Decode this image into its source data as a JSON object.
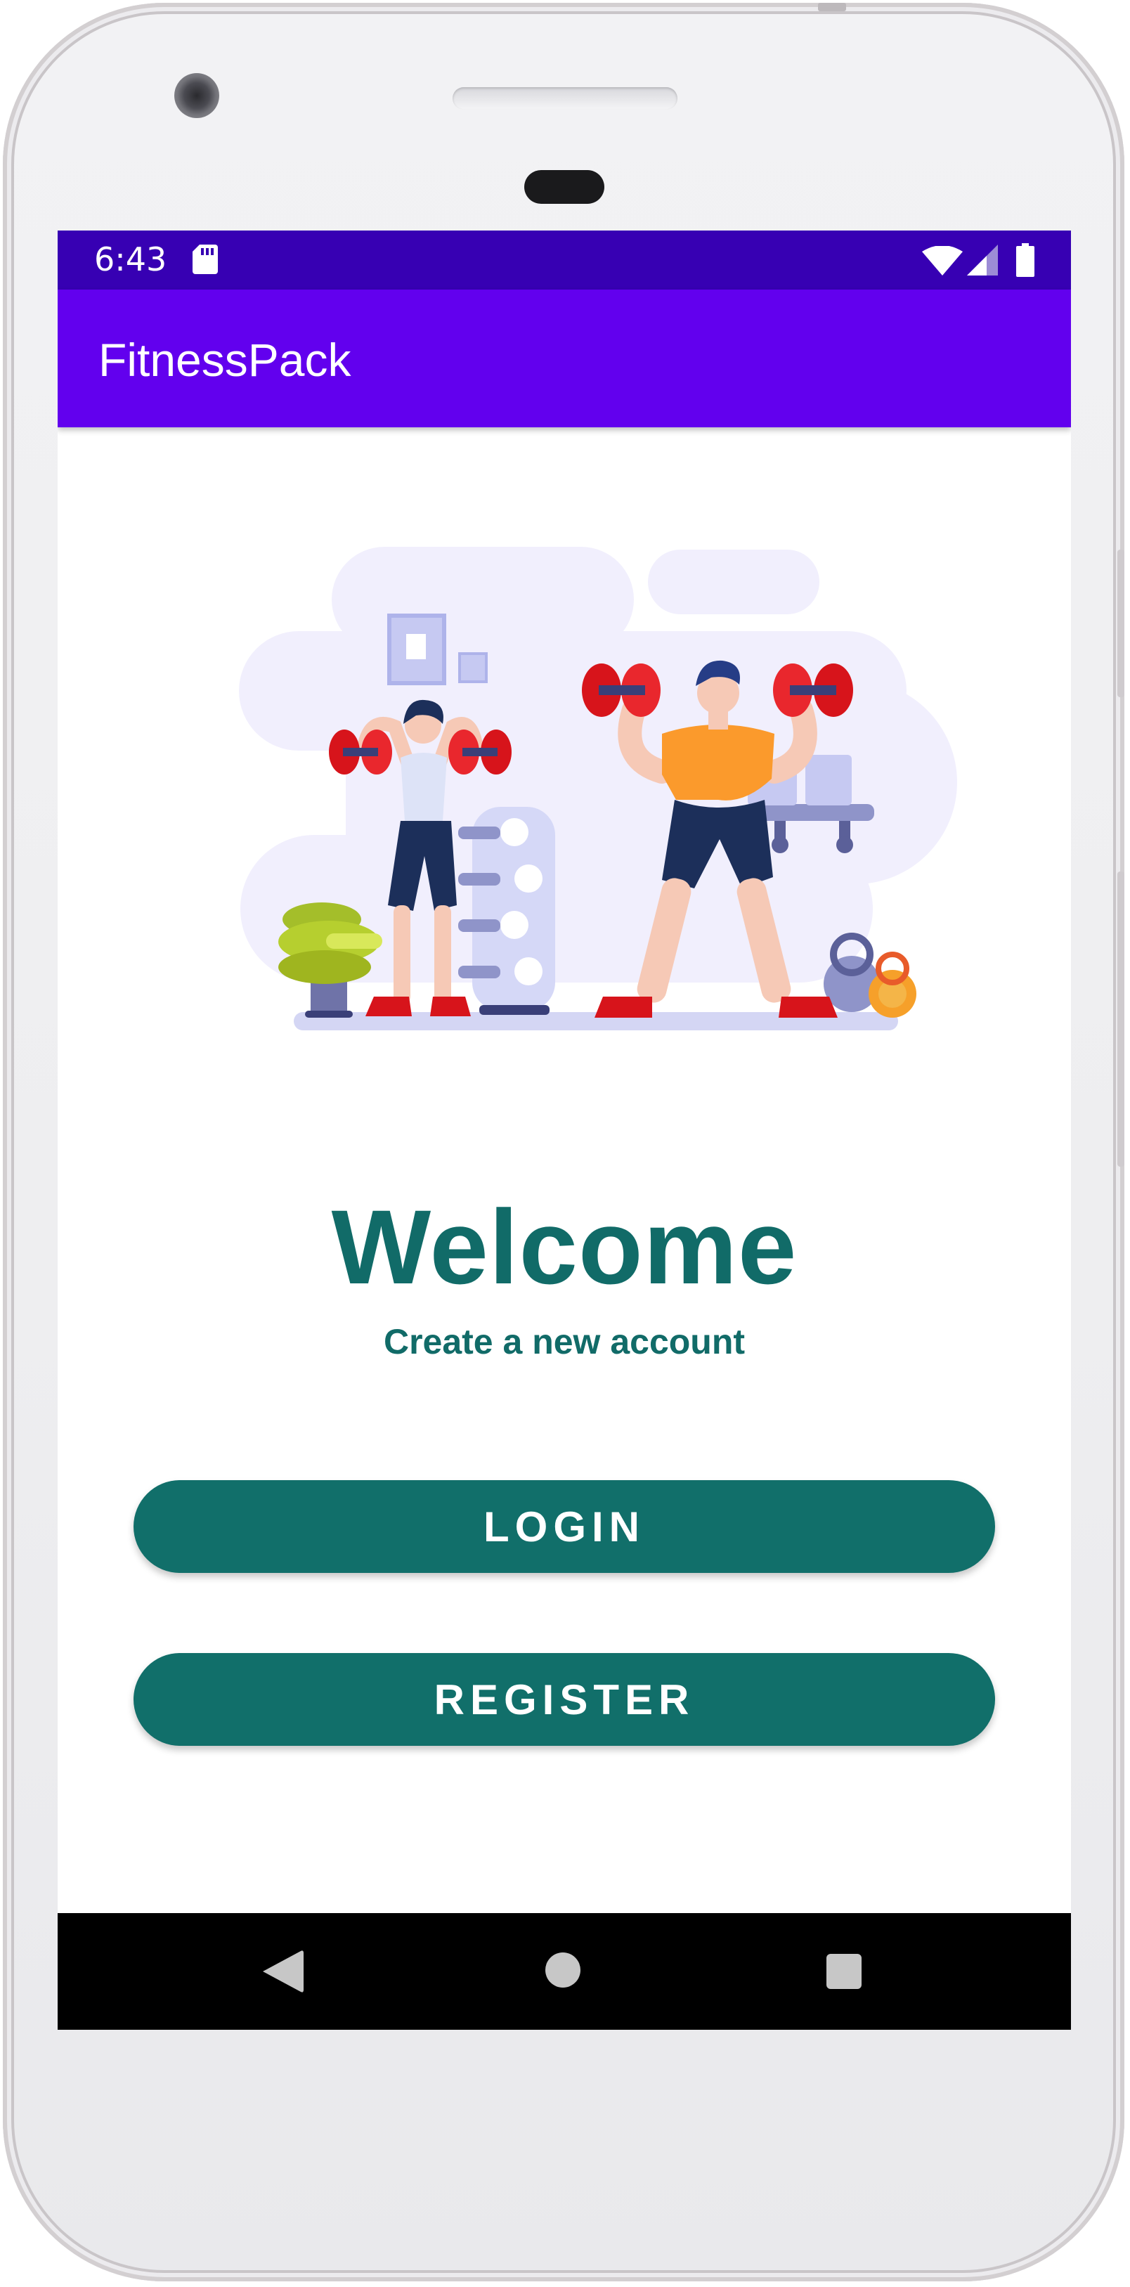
{
  "status_bar": {
    "time": "6:43",
    "icons": [
      "sd-card-icon",
      "wifi-icon",
      "signal-icon",
      "battery-icon"
    ]
  },
  "app_bar": {
    "title": "FitnessPack"
  },
  "illustration": {
    "icon": "gym-workout-illustration"
  },
  "welcome": {
    "title": "Welcome",
    "subtitle": "Create a new account"
  },
  "buttons": {
    "login_label": "LOGIN",
    "register_label": "REGISTER"
  },
  "nav_bar": {
    "icons": [
      "back-icon",
      "home-icon",
      "recents-icon"
    ]
  },
  "colors": {
    "status_bar": "#3700b3",
    "app_bar": "#6200ee",
    "accent": "#116f6a",
    "nav_bar": "#000000"
  }
}
